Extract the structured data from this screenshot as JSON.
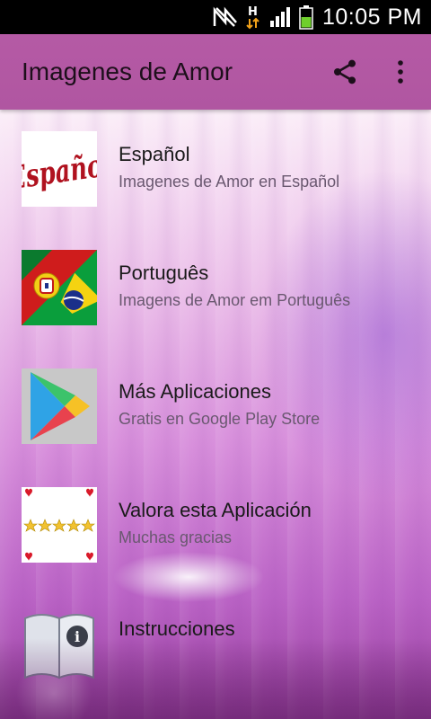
{
  "status_bar": {
    "time": "10:05 PM",
    "icons": [
      "no-signal-icon",
      "data-h-icon",
      "cell-signal-icon",
      "battery-icon"
    ]
  },
  "app_bar": {
    "title": "Imagenes de Amor",
    "actions": [
      "share-icon",
      "overflow-menu-icon"
    ]
  },
  "menu": {
    "items": [
      {
        "title": "Español",
        "subtitle": "Imagenes de Amor en Español",
        "icon": "espanol-logo",
        "logo_text": "Español"
      },
      {
        "title": "Português",
        "subtitle": "Imagens de Amor em Português",
        "icon": "portugal-brazil-flag-icon"
      },
      {
        "title": "Más Aplicaciones",
        "subtitle": "Gratis en Google Play Store",
        "icon": "google-play-icon"
      },
      {
        "title": "Valora esta Aplicación",
        "subtitle": "Muchas gracias",
        "icon": "five-stars-icon"
      },
      {
        "title": "Instrucciones",
        "subtitle": "",
        "icon": "book-info-icon"
      }
    ]
  },
  "colors": {
    "app_bar": "#b056a1",
    "status_bar": "#000000",
    "primary_text": "#1a1a1a",
    "secondary_text": "#6a5870"
  }
}
